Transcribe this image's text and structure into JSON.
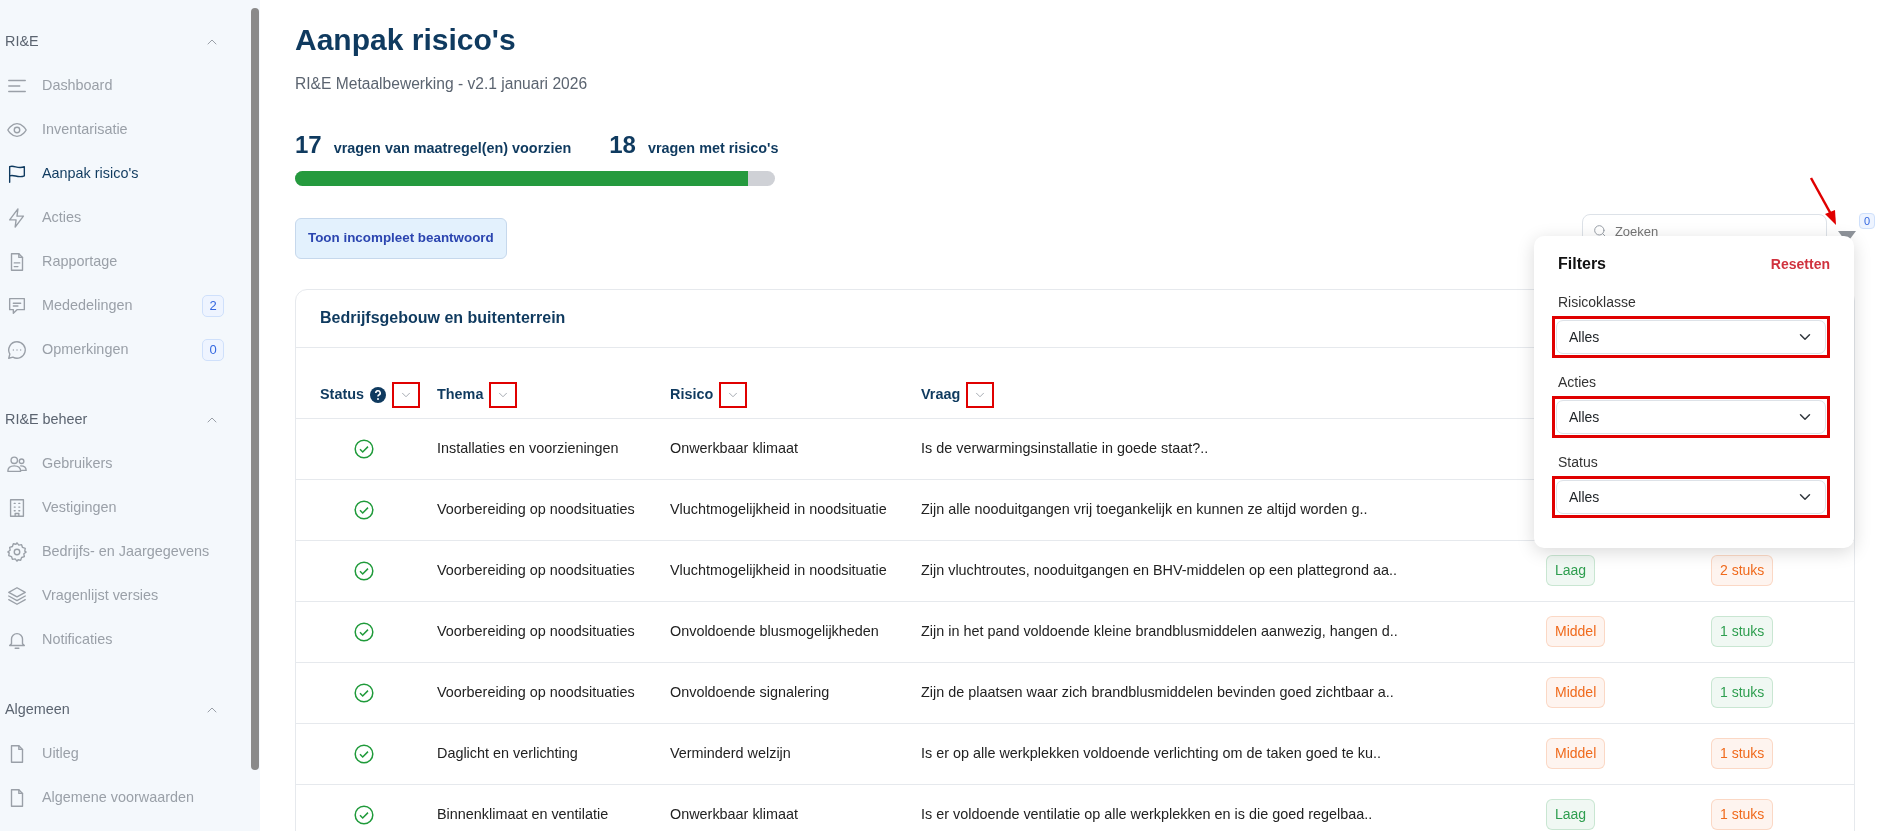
{
  "sidebar": {
    "sections": [
      {
        "title": "RI&E",
        "expanded": true,
        "items": [
          {
            "label": "Dashboard",
            "selected": false
          },
          {
            "label": "Inventarisatie",
            "selected": false
          },
          {
            "label": "Aanpak risico's",
            "selected": true
          },
          {
            "label": "Acties",
            "selected": false
          },
          {
            "label": "Rapportage",
            "selected": false
          },
          {
            "label": "Mededelingen",
            "selected": false,
            "count": "2"
          },
          {
            "label": "Opmerkingen",
            "selected": false,
            "count": "0"
          }
        ]
      },
      {
        "title": "RI&E beheer",
        "expanded": true,
        "items": [
          {
            "label": "Gebruikers",
            "selected": false
          },
          {
            "label": "Vestigingen",
            "selected": false
          },
          {
            "label": "Bedrijfs- en Jaargegevens",
            "selected": false
          },
          {
            "label": "Vragenlijst versies",
            "selected": false
          },
          {
            "label": "Notificaties",
            "selected": false
          }
        ]
      },
      {
        "title": "Algemeen",
        "expanded": true,
        "items": [
          {
            "label": "Uitleg",
            "selected": false
          },
          {
            "label": "Algemene voorwaarden",
            "selected": false
          }
        ]
      }
    ]
  },
  "page": {
    "title": "Aanpak risico's",
    "subtitle": "RI&E Metaalbewerking - v2.1 januari 2026",
    "stats": [
      {
        "number": "17",
        "label": "vragen van maatregel(en) voorzien"
      },
      {
        "number": "18",
        "label": "vragen met risico's"
      }
    ],
    "progress": {
      "level": 0.944
    },
    "incomplete_button": "Toon incompleet beantwoord",
    "search": {
      "placeholder": "Zoeken"
    },
    "filter_button": {
      "count": "0",
      "annotated": true
    }
  },
  "table": {
    "title": "Bedrijfsgebouw en buitenterrein",
    "columns": [
      {
        "label": "Status",
        "help": true,
        "highlighted": true
      },
      {
        "label": "Thema",
        "highlighted": true
      },
      {
        "label": "Risico",
        "highlighted": true
      },
      {
        "label": "Vraag",
        "highlighted": true
      }
    ],
    "rows": [
      {
        "answered": true,
        "thema": "Installaties en voorzieningen",
        "risico": "Onwerkbaar klimaat",
        "vraag": "Is de verwarmingsinstallatie in goede staat?.."
      },
      {
        "answered": true,
        "thema": "Voorbereiding op noodsituaties",
        "risico": "Vluchtmogelijkheid in noodsituatie",
        "vraag": "Zijn alle nooduitgangen vrij toegankelijk en kunnen ze altijd worden g.."
      },
      {
        "answered": true,
        "thema": "Voorbereiding op noodsituaties",
        "risico": "Vluchtmogelijkheid in noodsituatie",
        "vraag": "Zijn vluchtroutes, nooduitgangen en BHV-middelen op een plattegrond aa..",
        "risicoklasse": {
          "text": "Laag",
          "color": "#2e9e4f"
        },
        "acties": {
          "text": "2 stuks",
          "color": "#f06a1c"
        }
      },
      {
        "answered": true,
        "thema": "Voorbereiding op noodsituaties",
        "risico": "Onvoldoende blusmogelijkheden",
        "vraag": "Zijn in het pand voldoende kleine brandblusmiddelen aanwezig, hangen d..",
        "risicoklasse": {
          "text": "Middel",
          "color": "#f06a1c"
        },
        "acties": {
          "text": "1 stuks",
          "color": "#2e9e4f"
        }
      },
      {
        "answered": true,
        "thema": "Voorbereiding op noodsituaties",
        "risico": "Onvoldoende signalering",
        "vraag": "Zijn de plaatsen waar zich brandblusmiddelen bevinden goed zichtbaar a..",
        "risicoklasse": {
          "text": "Middel",
          "color": "#f06a1c"
        },
        "acties": {
          "text": "1 stuks",
          "color": "#2e9e4f"
        }
      },
      {
        "answered": true,
        "thema": "Daglicht en verlichting",
        "risico": "Verminderd welzijn",
        "vraag": "Is er op alle werkplekken voldoende verlichting om de taken goed te ku..",
        "risicoklasse": {
          "text": "Middel",
          "color": "#f06a1c"
        },
        "acties": {
          "text": "1 stuks",
          "color": "#f06a1c"
        }
      },
      {
        "answered": true,
        "thema": "Binnenklimaat en ventilatie",
        "risico": "Onwerkbaar klimaat",
        "vraag": "Is er voldoende ventilatie op alle werkplekken en is die goed regelbaa..",
        "risicoklasse": {
          "text": "Laag",
          "color": "#2e9e4f"
        },
        "acties": {
          "text": "1 stuks",
          "color": "#f06a1c"
        }
      }
    ]
  },
  "filter_popup": {
    "title": "Filters",
    "reset": "Resetten",
    "fields": [
      {
        "label": "Risicoklasse",
        "value": "Alles",
        "highlighted": true
      },
      {
        "label": "Acties",
        "value": "Alles",
        "highlighted": true
      },
      {
        "label": "Status",
        "value": "Alles",
        "highlighted": true
      }
    ]
  }
}
